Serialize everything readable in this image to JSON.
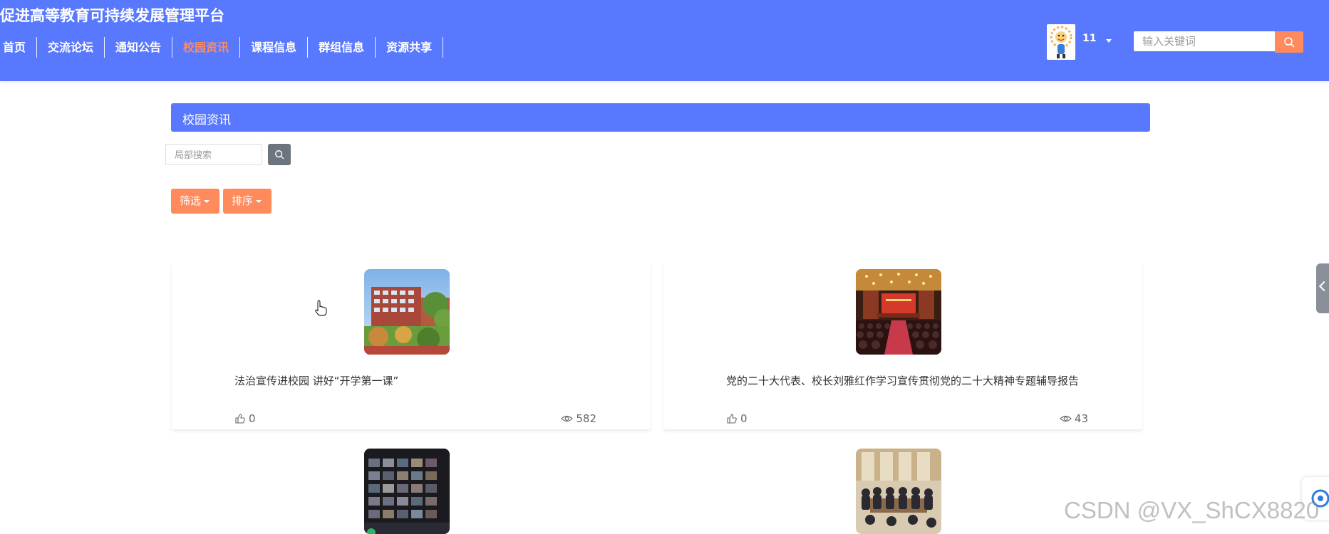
{
  "header": {
    "site_title": "促进高等教育可持续发展管理平台",
    "nav": [
      {
        "label": "首页",
        "active": false
      },
      {
        "label": "交流论坛",
        "active": false
      },
      {
        "label": "通知公告",
        "active": false
      },
      {
        "label": "校园资讯",
        "active": true
      },
      {
        "label": "课程信息",
        "active": false
      },
      {
        "label": "群组信息",
        "active": false
      },
      {
        "label": "资源共享",
        "active": false
      }
    ],
    "user_name": "11",
    "search_placeholder": "输入关键词"
  },
  "section": {
    "title": "校园资讯",
    "local_search_placeholder": "局部搜索",
    "filter_label": "筛选",
    "sort_label": "排序"
  },
  "cards": [
    {
      "title": "法治宣传进校园 讲好“开学第一课”",
      "likes": "0",
      "views": "582"
    },
    {
      "title": "党的二十大代表、校长刘雅红作学习宣传贯彻党的二十大精神专题辅导报告",
      "likes": "0",
      "views": "43"
    }
  ],
  "watermark": "CSDN @VX_ShCX8820",
  "colors": {
    "primary": "#5878fe",
    "accent": "#ff8a5c",
    "active_nav": "#ff8a5c"
  }
}
